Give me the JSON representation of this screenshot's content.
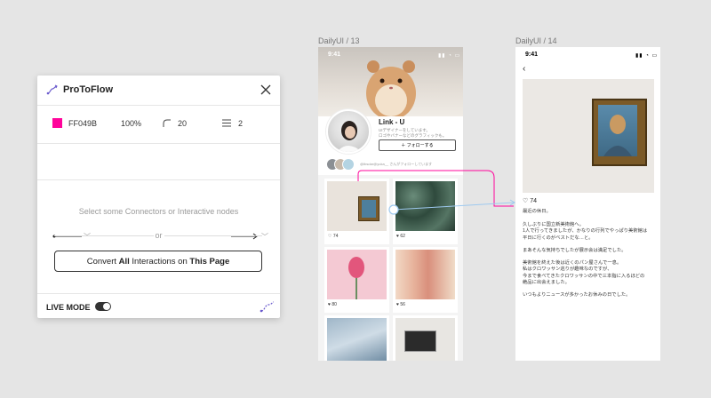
{
  "panel": {
    "title": "ProToFlow",
    "color_hex": "FF049B",
    "color_value": "#FF049B",
    "opacity": "100%",
    "corner_radius": "20",
    "stroke_width": "2",
    "empty_message": "Select some Connectors or Interactive nodes",
    "or_text": "or",
    "convert": {
      "pre": "Convert ",
      "bold1": "All",
      "mid": " Interactions on ",
      "bold2": "This Page"
    },
    "live_mode_label": "LIVE MODE",
    "live_mode_on": true
  },
  "artboards": {
    "ab13": {
      "label": "DailyUI / 13",
      "time": "9:41",
      "user_name": "Link - U",
      "bio": "UIデザイナーをしています。\nロゴやバナーなどのグラフィックも。",
      "follow_label": "＋ フォローする",
      "followers_text": "@tbsdar@yuka__ さんがフォローしています",
      "posts": [
        {
          "likes": "74"
        },
        {
          "likes": "62"
        },
        {
          "likes": "80"
        },
        {
          "likes": "56"
        }
      ]
    },
    "ab14": {
      "label": "DailyUI / 14",
      "time": "9:41",
      "likes": "74",
      "p1": "最近の休日。",
      "p2": "久しぶりに国立新美術館へ。\n1人で行ってきましたが、かなりの行列でやっぱり美術館は\n平日に行くのがベストだな…と。",
      "p3": "まあそんな気持ちでしたが展示会は満足でした。",
      "p4": "美術館を終えた後は近くのパン屋さんで一息。\n私はクロワッサン巡りが趣味なのですが、\n今まで食べてきたクロワッサンの中で三本指に入るほどの\n絶品に出会えました。",
      "p5": "いつもよりニュースが多かったお休みの日でした。"
    }
  },
  "colors": {
    "accent": "#FF049B",
    "connector_blue": "#9ec9ef"
  }
}
